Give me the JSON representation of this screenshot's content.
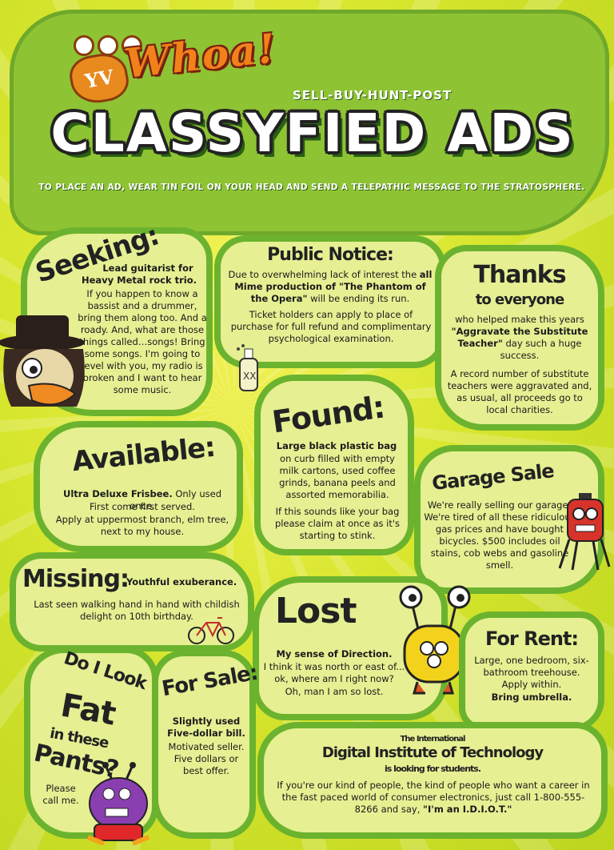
{
  "header": {
    "logo_yv": "YV",
    "logo_whoa": "Whoa!",
    "tagline": "SELL-BUY-HUNT-POST",
    "title": "CLASSYFIED ADS",
    "subline": "TO PLACE AN AD, WEAR TIN FOIL ON YOUR HEAD AND SEND A TELEPATHIC MESSAGE TO THE STRATOSPHERE."
  },
  "ads": {
    "seeking": {
      "heading": "Seeking:",
      "lead": "Lead guitarist for",
      "lead_bold": "Heavy Metal rock trio.",
      "body": "If you happen to know a bassist and a drummer, bring them along too. And a roady. And, what are those things called…songs! Bring some songs. I'm going to level with you, my radio is broken and I want to hear some music."
    },
    "public_notice": {
      "heading": "Public Notice:",
      "text1": "Due to overwhelming lack of interest the",
      "text_bold": "all Mime production of \"The Phantom of the Opera\"",
      "text2": "will be ending its run.",
      "text3": "Ticket holders can apply to place of purchase for full refund and complimentary psychological examination."
    },
    "thanks": {
      "heading1": "Thanks",
      "heading2": "to everyone",
      "text1": "who helped make this years",
      "text_bold": "\"Aggravate the Substitute Teacher\"",
      "text2": "day such a huge success.",
      "text3": "A record number of substitute teachers were aggravated and, as usual, all proceeds go to local charities."
    },
    "found": {
      "heading": "Found:",
      "text_bold": "Large black plastic bag",
      "text1": "on curb filled with empty milk cartons, used coffee grinds, banana peels and assorted memorabilia.",
      "text2": "If this sounds like your bag please claim at once as it's starting to stink."
    },
    "available": {
      "heading": "Available:",
      "text_bold": "Ultra Deluxe Frisbee.",
      "text1": "Only used once.",
      "text2": "First come first served.",
      "text3": "Apply at uppermost branch, elm tree, next to my house."
    },
    "garage_sale": {
      "heading": "Garage Sale",
      "text": "We're really selling our garage! We're tired of all these ridiculous gas prices and have bought bicycles. $500 includes oil stains, cob webs and gasoline smell."
    },
    "missing": {
      "heading": "Missing:",
      "lead_bold": "Youthful exuberance.",
      "text": "Last seen walking hand in hand with childish delight on 10th birthday."
    },
    "lost": {
      "heading": "Lost",
      "text_bold": "My sense of Direction.",
      "text1": "I think it was north or east of... ok, where am I right now?",
      "text2": "Oh, man I am so lost."
    },
    "for_rent": {
      "heading": "For Rent:",
      "text": "Large, one bedroom, six-bathroom treehouse. Apply within.",
      "text_bold": "Bring umbrella."
    },
    "fat": {
      "heading1": "Do I Look",
      "heading2": "Fat",
      "heading3": "in these",
      "heading4": "Pants?",
      "text": "Please call me."
    },
    "for_sale": {
      "heading": "For Sale:",
      "text_bold": "Slightly used Five-dollar bill.",
      "text": "Motivated seller. Five dollars or best offer."
    },
    "idiot": {
      "heading1": "The International",
      "heading2": "Digital Institute of Technology",
      "heading3": "is looking for students.",
      "text": "If you're our kind of people, the kind of people who want a career in the fast paced world of consumer electronics, just call 1-800-555-8266 and say,",
      "text_bold": "\"I'm an I.D.I.O.T.\""
    }
  },
  "colors": {
    "background": "#d8e62e",
    "panel": "#8ec334",
    "bubble": "#e6ef92",
    "bubble_border": "#6bb32e",
    "logo_orange": "#f1821b"
  }
}
